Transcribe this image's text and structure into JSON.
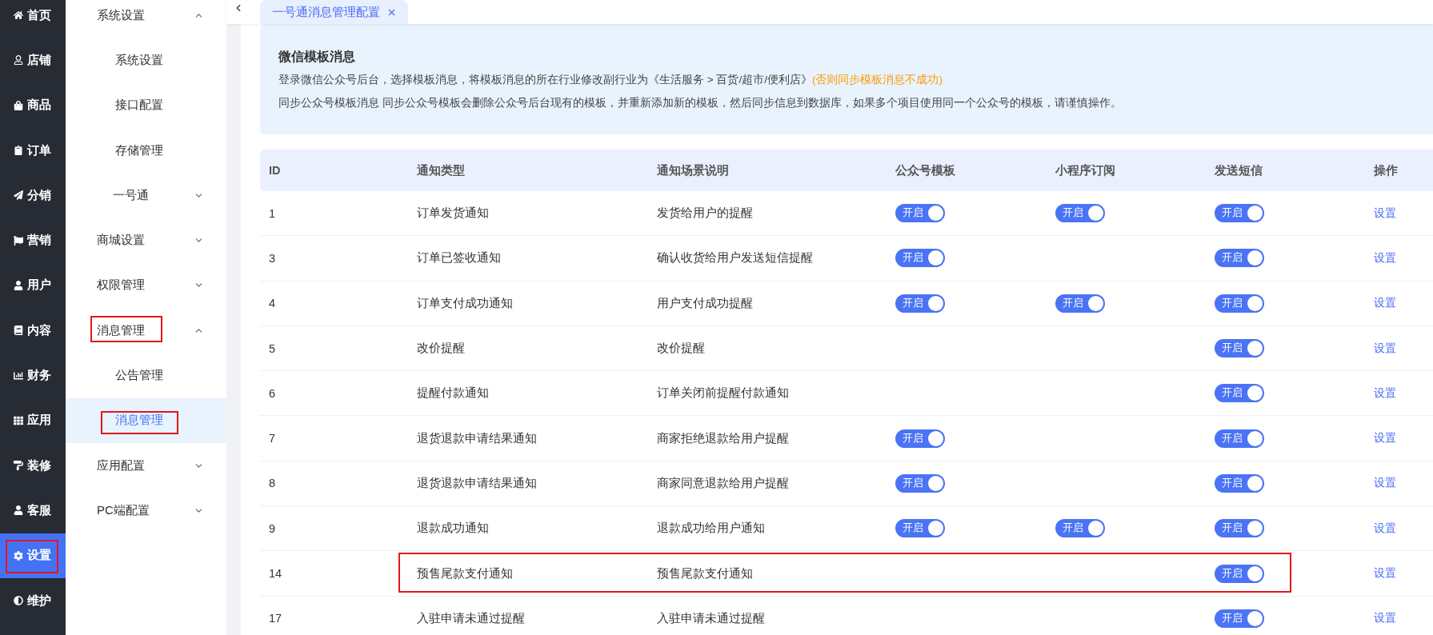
{
  "rail": [
    {
      "label": "首页",
      "selected": false,
      "highlighted": false
    },
    {
      "label": "店铺",
      "selected": false,
      "highlighted": false
    },
    {
      "label": "商品",
      "selected": false,
      "highlighted": false
    },
    {
      "label": "订单",
      "selected": false,
      "highlighted": false
    },
    {
      "label": "分销",
      "selected": false,
      "highlighted": false
    },
    {
      "label": "营销",
      "selected": false,
      "highlighted": false
    },
    {
      "label": "用户",
      "selected": false,
      "highlighted": false
    },
    {
      "label": "内容",
      "selected": false,
      "highlighted": false
    },
    {
      "label": "财务",
      "selected": false,
      "highlighted": false
    },
    {
      "label": "应用",
      "selected": false,
      "highlighted": false
    },
    {
      "label": "装修",
      "selected": false,
      "highlighted": false
    },
    {
      "label": "客服",
      "selected": false,
      "highlighted": false
    },
    {
      "label": "设置",
      "selected": true,
      "highlighted": true
    },
    {
      "label": "维护",
      "selected": false,
      "highlighted": false
    }
  ],
  "submenu": [
    {
      "label": "系统设置",
      "expanded": true,
      "highlighted": false,
      "children": [
        {
          "kind": "item",
          "label": "系统设置",
          "selected": false,
          "highlighted": false
        },
        {
          "kind": "item",
          "label": "接口配置",
          "selected": false,
          "highlighted": false
        },
        {
          "kind": "item",
          "label": "存储管理",
          "selected": false,
          "highlighted": false
        },
        {
          "kind": "group",
          "label": "一号通",
          "expanded": false,
          "selected": false,
          "highlighted": false
        }
      ]
    },
    {
      "label": "商城设置",
      "expanded": false,
      "highlighted": false
    },
    {
      "label": "权限管理",
      "expanded": false,
      "highlighted": false
    },
    {
      "label": "消息管理",
      "expanded": true,
      "highlighted": true,
      "children": [
        {
          "kind": "item",
          "label": "公告管理",
          "selected": false,
          "highlighted": false
        },
        {
          "kind": "item",
          "label": "消息管理",
          "selected": true,
          "highlighted": true
        }
      ]
    },
    {
      "label": "应用配置",
      "expanded": false,
      "highlighted": false
    },
    {
      "label": "PC端配置",
      "expanded": false,
      "highlighted": false
    }
  ],
  "tabs": [
    {
      "label": "一号通消息管理配置",
      "selected": true
    }
  ],
  "notice": {
    "title": "微信模板消息",
    "lines": [
      {
        "text": "登录微信公众号后台，选择模板消息，将模板消息的所在行业修改副行业为《生活服务 > 百货/超市/便利店》",
        "warning": "(否则同步模板消息不成功)"
      },
      {
        "text": "同步公众号模板消息 同步公众号模板会删除公众号后台现有的模板，并重新添加新的模板，然后同步信息到数据库，如果多个项目使用同一个公众号的模板，请谨慎操作。"
      }
    ]
  },
  "table": {
    "columns": [
      "ID",
      "通知类型",
      "通知场景说明",
      "公众号模板",
      "小程序订阅",
      "发送短信",
      "操作"
    ],
    "rows": [
      {
        "id": "1",
        "type": "订单发货通知",
        "scene": "发货给用户的提醒",
        "wechat_template": {
          "label": "开启",
          "on": true
        },
        "mini_program": {
          "label": "开启",
          "on": true
        },
        "sms": {
          "label": "开启",
          "on": true
        },
        "action": "设置",
        "highlighted": false
      },
      {
        "id": "3",
        "type": "订单已签收通知",
        "scene": "确认收货给用户发送短信提醒",
        "wechat_template": {
          "label": "开启",
          "on": true
        },
        "sms": {
          "label": "开启",
          "on": true
        },
        "action": "设置",
        "highlighted": false
      },
      {
        "id": "4",
        "type": "订单支付成功通知",
        "scene": "用户支付成功提醒",
        "wechat_template": {
          "label": "开启",
          "on": true
        },
        "mini_program": {
          "label": "开启",
          "on": true
        },
        "sms": {
          "label": "开启",
          "on": true
        },
        "action": "设置",
        "highlighted": false
      },
      {
        "id": "5",
        "type": "改价提醒",
        "scene": "改价提醒",
        "sms": {
          "label": "开启",
          "on": true
        },
        "action": "设置",
        "highlighted": false
      },
      {
        "id": "6",
        "type": "提醒付款通知",
        "scene": "订单关闭前提醒付款通知",
        "sms": {
          "label": "开启",
          "on": true
        },
        "action": "设置",
        "highlighted": false
      },
      {
        "id": "7",
        "type": "退货退款申请结果通知",
        "scene": "商家拒绝退款给用户提醒",
        "wechat_template": {
          "label": "开启",
          "on": true
        },
        "sms": {
          "label": "开启",
          "on": true
        },
        "action": "设置",
        "highlighted": false
      },
      {
        "id": "8",
        "type": "退货退款申请结果通知",
        "scene": "商家同意退款给用户提醒",
        "wechat_template": {
          "label": "开启",
          "on": true
        },
        "sms": {
          "label": "开启",
          "on": true
        },
        "action": "设置",
        "highlighted": false
      },
      {
        "id": "9",
        "type": "退款成功通知",
        "scene": "退款成功给用户通知",
        "wechat_template": {
          "label": "开启",
          "on": true
        },
        "mini_program": {
          "label": "开启",
          "on": true
        },
        "sms": {
          "label": "开启",
          "on": true
        },
        "action": "设置",
        "highlighted": false
      },
      {
        "id": "14",
        "type": "预售尾款支付通知",
        "scene": "预售尾款支付通知",
        "sms": {
          "label": "开启",
          "on": true
        },
        "action": "设置",
        "highlighted": true
      },
      {
        "id": "17",
        "type": "入驻申请未通过提醒",
        "scene": "入驻申请未通过提醒",
        "sms": {
          "label": "开启",
          "on": true
        },
        "action": "设置",
        "highlighted": false
      }
    ]
  }
}
